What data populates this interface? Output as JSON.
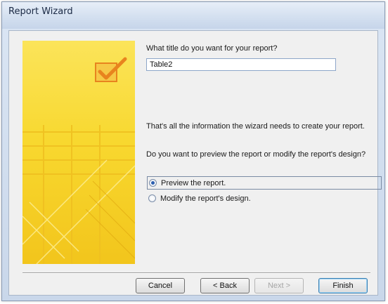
{
  "window": {
    "title": "Report Wizard"
  },
  "form": {
    "title_question": "What title do you want for your report?",
    "title_value": "Table2",
    "info_text": "That's all the information the wizard needs to create your report.",
    "preview_question": "Do you want to preview the report or modify the report's design?",
    "options": [
      {
        "label": "Preview the report.",
        "selected": true
      },
      {
        "label": "Modify the report's design.",
        "selected": false
      }
    ]
  },
  "buttons": {
    "cancel": "Cancel",
    "back": "< Back",
    "next": "Next >",
    "finish": "Finish"
  },
  "colors": {
    "art_yellow": "#f8d82f",
    "check_orange": "#e8841e"
  },
  "icons": {
    "art_check": "checkmark-icon"
  }
}
